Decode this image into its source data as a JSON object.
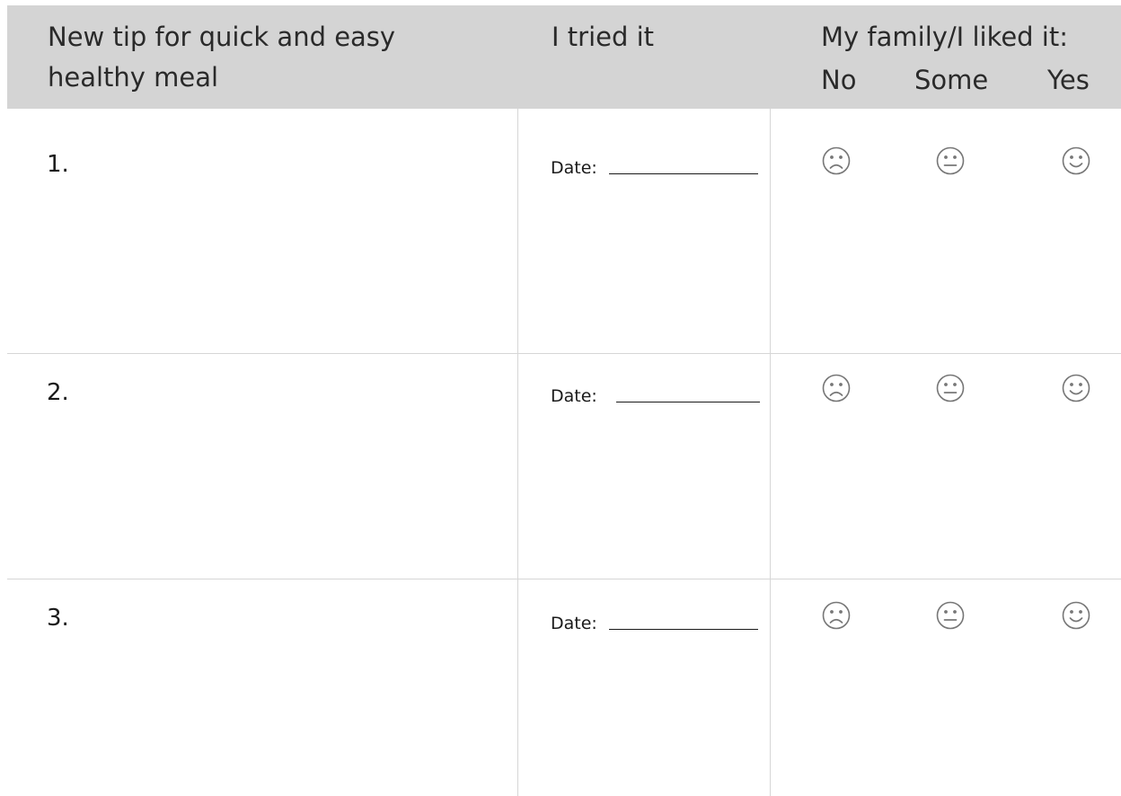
{
  "header": {
    "tip_line1": "New tip for quick and easy",
    "tip_line2": "healthy meal",
    "tried": "I tried it",
    "liked": "My family/I liked it:",
    "rating_no": "No",
    "rating_some": "Some",
    "rating_yes": "Yes"
  },
  "rows": [
    {
      "number": "1.",
      "date_label": "Date:"
    },
    {
      "number": "2.",
      "date_label": "Date:"
    },
    {
      "number": "3.",
      "date_label": "Date:"
    }
  ],
  "icons": {
    "no": "frown-face-icon",
    "some": "neutral-face-icon",
    "yes": "smile-face-icon"
  },
  "colors": {
    "header_background": "#d4d4d4",
    "grid_lines": "#d6d6d6",
    "text": "#222222"
  }
}
